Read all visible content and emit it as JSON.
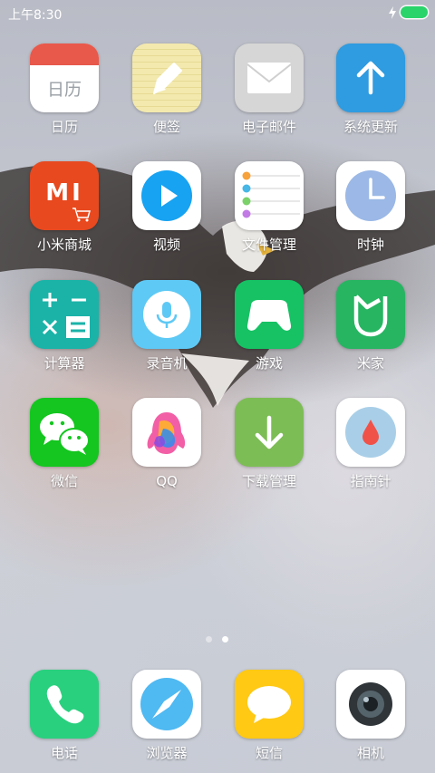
{
  "status": {
    "time": "上午8:30"
  },
  "apps": [
    {
      "label": "日历",
      "icon": "calendar-icon",
      "icon_text": "日历"
    },
    {
      "label": "便签",
      "icon": "notes-pencil-icon"
    },
    {
      "label": "电子邮件",
      "icon": "mail-envelope-icon"
    },
    {
      "label": "系统更新",
      "icon": "update-arrow-icon"
    },
    {
      "label": "小米商城",
      "icon": "mi-store-icon",
      "icon_text": "MI"
    },
    {
      "label": "视频",
      "icon": "video-play-icon"
    },
    {
      "label": "文件管理",
      "icon": "file-list-icon"
    },
    {
      "label": "时钟",
      "icon": "clock-icon"
    },
    {
      "label": "计算器",
      "icon": "calculator-icon"
    },
    {
      "label": "录音机",
      "icon": "microphone-icon"
    },
    {
      "label": "游戏",
      "icon": "gamepad-icon"
    },
    {
      "label": "米家",
      "icon": "mijia-icon"
    },
    {
      "label": "微信",
      "icon": "wechat-icon"
    },
    {
      "label": "QQ",
      "icon": "qq-penguin-icon"
    },
    {
      "label": "下载管理",
      "icon": "download-arrow-icon"
    },
    {
      "label": "指南针",
      "icon": "compass-drop-icon"
    }
  ],
  "dock": [
    {
      "label": "电话",
      "icon": "phone-icon"
    },
    {
      "label": "浏览器",
      "icon": "browser-compass-icon"
    },
    {
      "label": "短信",
      "icon": "message-bubble-icon"
    },
    {
      "label": "相机",
      "icon": "camera-lens-icon"
    }
  ],
  "page_indicator": {
    "count": 2,
    "active": 2
  },
  "colors": {
    "status_battery": "#2bd36b",
    "calendar_red": "#e8584b",
    "notes_yellow": "#f1e6a6",
    "update_blue": "#2f9be0",
    "mi_orange": "#e8491f",
    "video_blue": "#17a2f2",
    "game_green": "#16c264",
    "mijia_green": "#27b562",
    "wechat_green": "#14c61f",
    "download_green": "#7dbd55",
    "compass_red": "#f0524a",
    "phone_green": "#29d07e",
    "sms_yellow": "#ffc914"
  }
}
